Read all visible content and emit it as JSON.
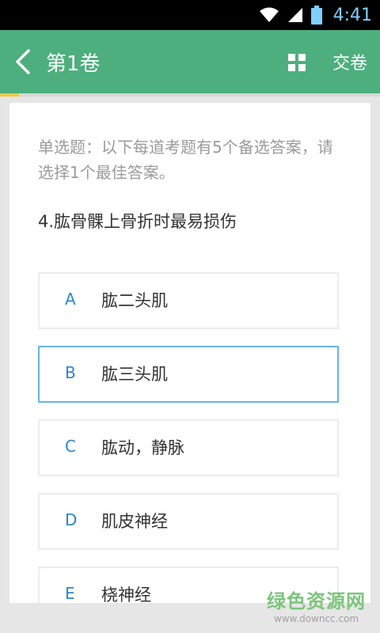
{
  "status_bar": {
    "time": "4:41",
    "icons": [
      "wifi-icon",
      "signal-icon",
      "battery-icon"
    ]
  },
  "app_bar": {
    "title": "第1卷",
    "submit_label": "交卷",
    "icons": [
      "back-arrow-icon",
      "grid-icon"
    ]
  },
  "progress": {
    "fraction": 0.05
  },
  "exam": {
    "instruction": "单选题：以下每道考题有5个备选答案，请选择1个最佳答案。",
    "question": "4.肱骨髁上骨折时最易损伤",
    "options": [
      {
        "letter": "A",
        "text": "肱二头肌"
      },
      {
        "letter": "B",
        "text": "肱三头肌"
      },
      {
        "letter": "C",
        "text": "肱动，静脉"
      },
      {
        "letter": "D",
        "text": "肌皮神经"
      },
      {
        "letter": "E",
        "text": "桡神经"
      }
    ],
    "selected_letter": "B"
  },
  "watermark": {
    "main": "绿色资源网",
    "sub": "www.downcc.com"
  },
  "colors": {
    "app_bar": "#4caf7d",
    "progress": "#f2c744",
    "accent": "#2e86c9",
    "selected_border": "#6ab3e6"
  }
}
